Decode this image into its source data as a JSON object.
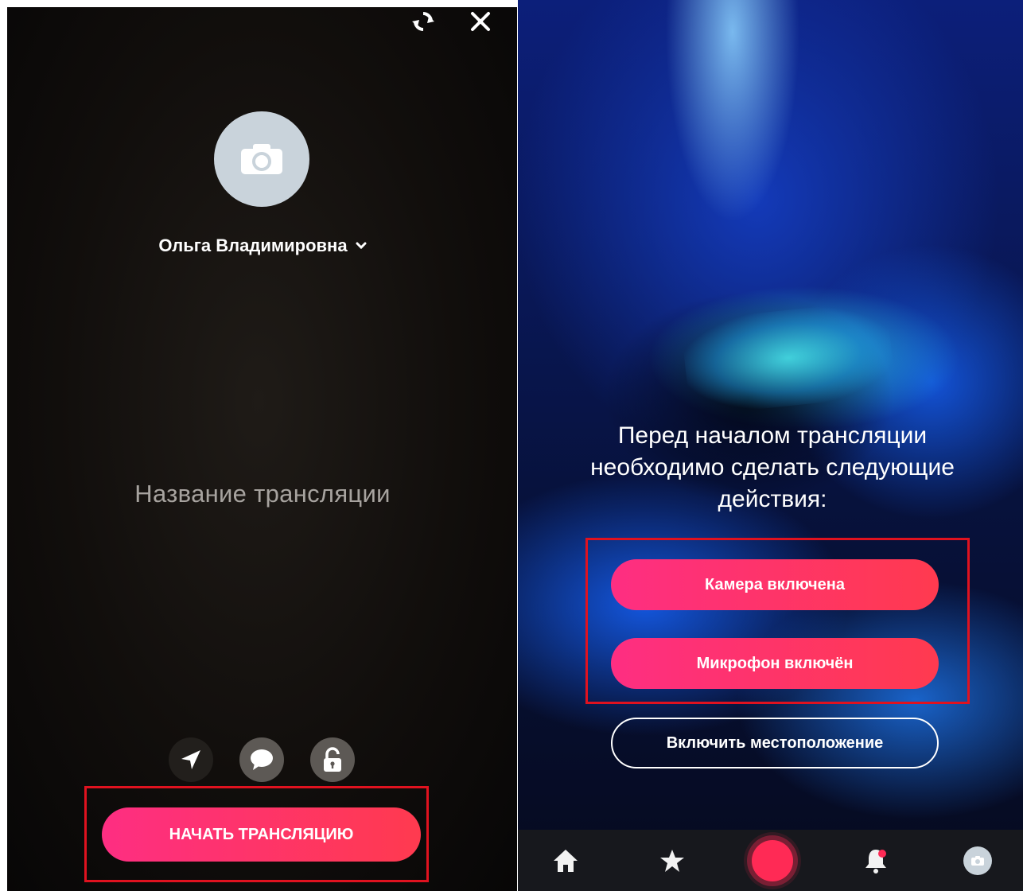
{
  "left_screen": {
    "user_name": "Ольга Владимировна",
    "stream_title_placeholder": "Название трансляции",
    "start_button_label": "НАЧАТЬ ТРАНСЛЯЦИЮ",
    "icons": {
      "refresh": "refresh-icon",
      "close": "close-icon",
      "avatar": "camera-icon",
      "dropdown": "chevron-down-icon",
      "location": "location-arrow-icon",
      "chat": "chat-bubble-icon",
      "privacy": "unlocked-icon"
    }
  },
  "right_screen": {
    "prompt_lines": [
      "Перед началом трансляции",
      "необходимо сделать следующие",
      "действия:"
    ],
    "camera_button_label": "Камера включена",
    "microphone_button_label": "Микрофон включён",
    "location_button_label": "Включить местоположение",
    "tabbar": [
      "home-icon",
      "star-icon",
      "record-icon",
      "bell-icon",
      "profile-camera-icon"
    ]
  },
  "colors": {
    "accent_start": "#fe2e82",
    "accent_end": "#ff3a4f",
    "highlight_box": "#e0121f",
    "tabbar_bg": "#17181d",
    "notification_dot": "#ff2a55"
  }
}
